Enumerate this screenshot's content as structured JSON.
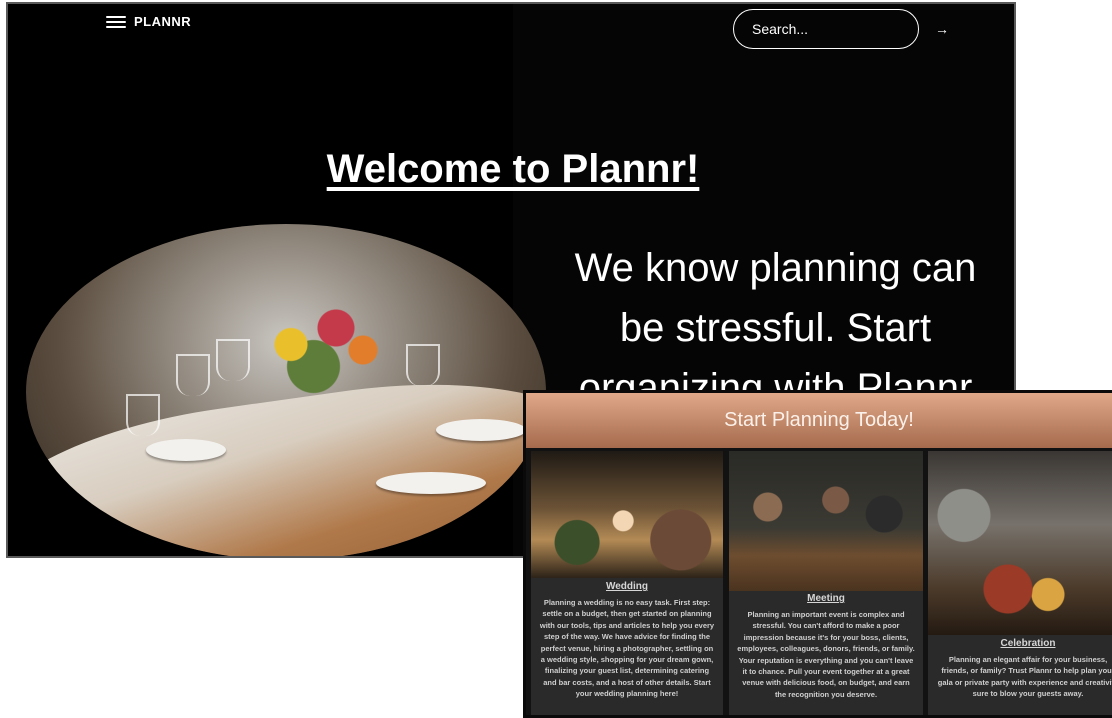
{
  "header": {
    "brand": "PLANNR",
    "search": {
      "placeholder": "Search...",
      "arrow": "→"
    }
  },
  "hero": {
    "title": "Welcome to Plannr!",
    "tagline": "We know planning can be stressful. Start organizing with Plannr"
  },
  "planning": {
    "title": "Start Planning Today!",
    "cards": [
      {
        "title": "Wedding",
        "text": "Planning a wedding is no easy task. First step: settle on a budget, then get started on planning with our tools, tips and articles to help you every step of the way. We have advice for finding the perfect venue, hiring a photographer, settling on a wedding style, shopping for your dream gown, finalizing your guest list, determining catering and bar costs, and a host of other details. Start your wedding planning here!"
      },
      {
        "title": "Meeting",
        "text": "Planning an important event is complex and stressful. You can't afford to make a poor impression because it's for your boss, clients, employees, colleagues, donors, friends, or family. Your reputation is everything and you can't leave it to chance. Pull your event together at a great venue with delicious food, on budget, and earn the recognition you deserve."
      },
      {
        "title": "Celebration",
        "text": "Planning an elegant affair for your business, friends, or family? Trust Plannr to help plan your gala or private party with experience and creativity sure to blow your guests away."
      }
    ]
  }
}
